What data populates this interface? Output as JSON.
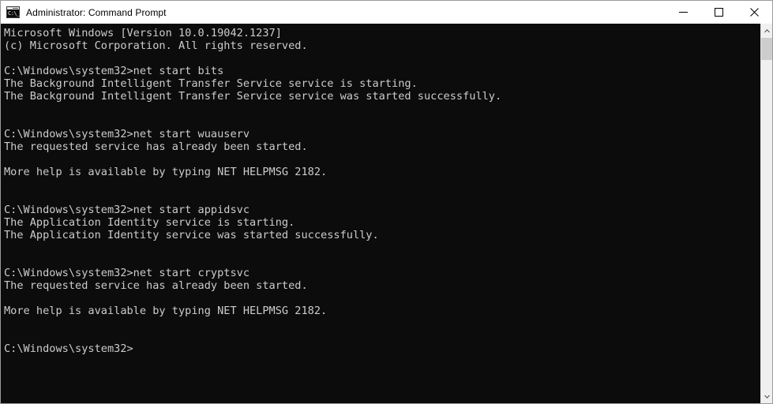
{
  "window": {
    "title": "Administrator: Command Prompt",
    "app_icon": "command-prompt-icon",
    "icon_glyph": "C:\\_",
    "background_color": "#0c0c0c",
    "titlebar_color": "#ffffff",
    "text_color": "#cccccc"
  },
  "controls": {
    "minimize": "Minimize",
    "maximize": "Maximize",
    "close": "Close"
  },
  "scrollbar": {
    "up_arrow": "scroll-up-arrow-icon",
    "down_arrow": "scroll-down-arrow-icon",
    "thumb": "scrollbar-thumb"
  },
  "console": {
    "prompt": "C:\\Windows\\system32>",
    "lines": [
      "Microsoft Windows [Version 10.0.19042.1237]",
      "(c) Microsoft Corporation. All rights reserved.",
      "",
      "C:\\Windows\\system32>net start bits",
      "The Background Intelligent Transfer Service service is starting.",
      "The Background Intelligent Transfer Service service was started successfully.",
      "",
      "",
      "C:\\Windows\\system32>net start wuauserv",
      "The requested service has already been started.",
      "",
      "More help is available by typing NET HELPMSG 2182.",
      "",
      "",
      "C:\\Windows\\system32>net start appidsvc",
      "The Application Identity service is starting.",
      "The Application Identity service was started successfully.",
      "",
      "",
      "C:\\Windows\\system32>net start cryptsvc",
      "The requested service has already been started.",
      "",
      "More help is available by typing NET HELPMSG 2182.",
      "",
      "",
      "C:\\Windows\\system32>"
    ]
  }
}
